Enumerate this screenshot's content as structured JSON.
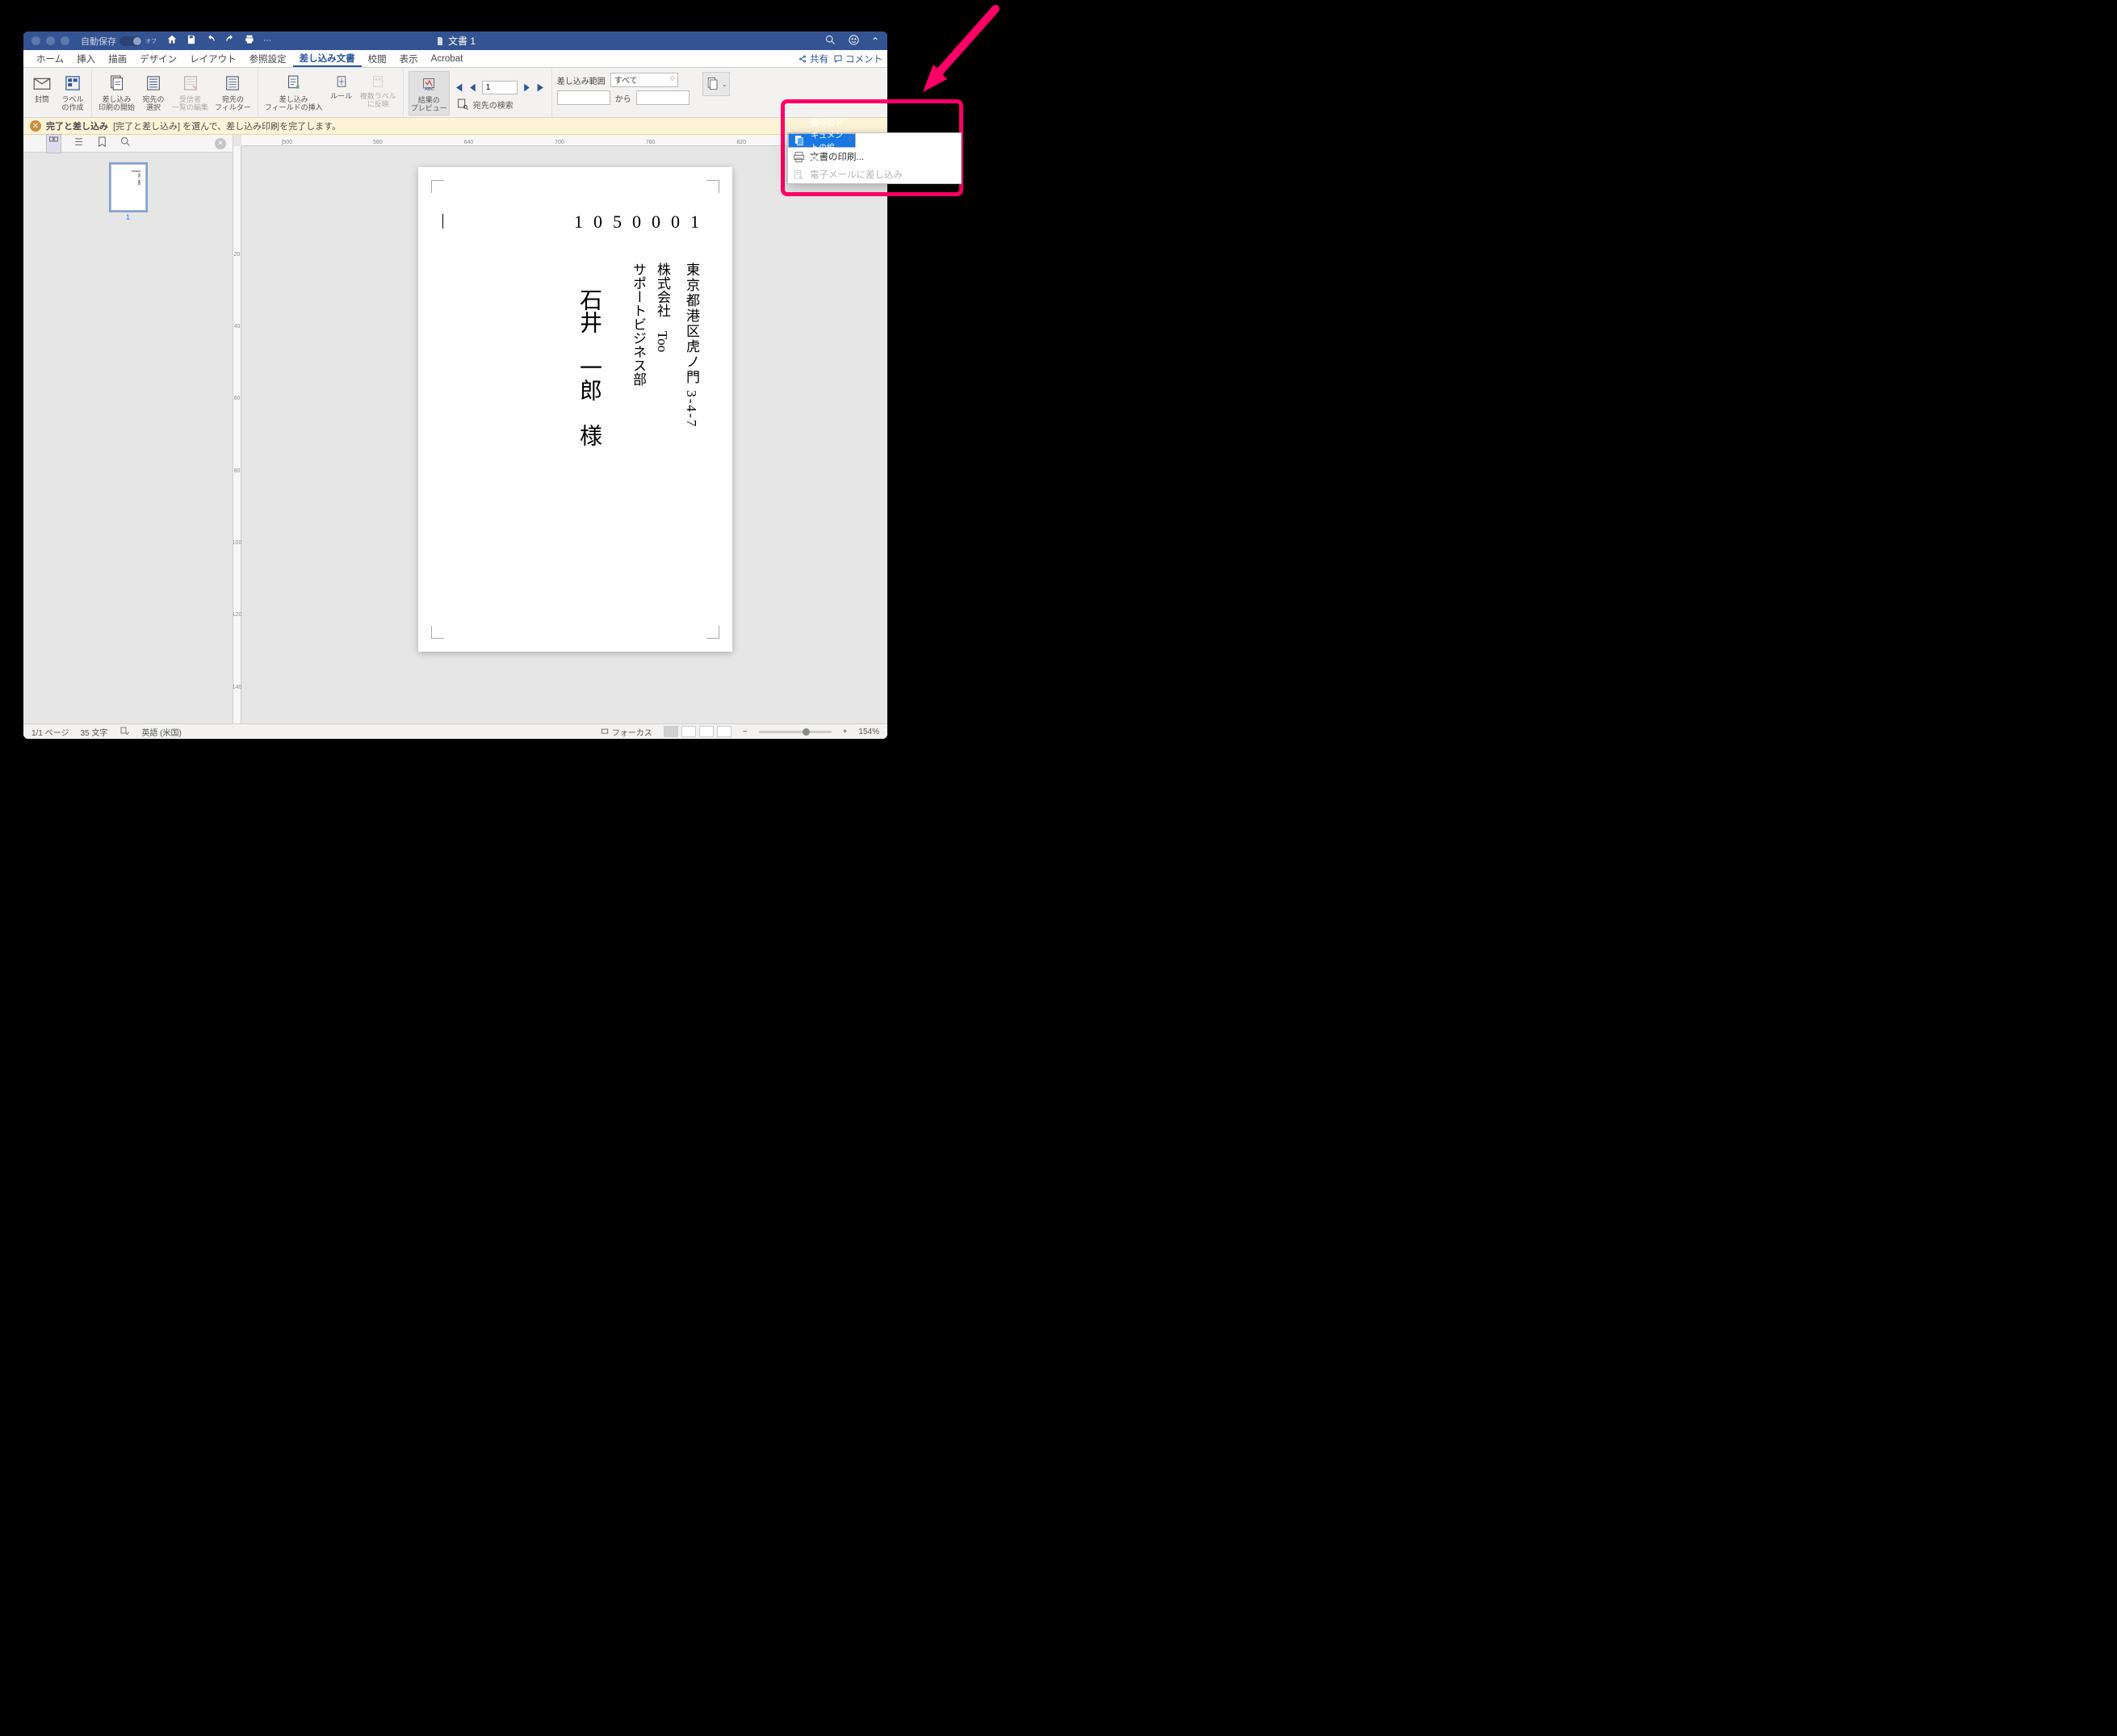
{
  "titlebar": {
    "autosave_label": "自動保存",
    "autosave_state": "オフ",
    "document_title": "文書 1"
  },
  "tabs": {
    "items": [
      "ホーム",
      "挿入",
      "描画",
      "デザイン",
      "レイアウト",
      "参照設定",
      "差し込み文書",
      "校閲",
      "表示",
      "Acrobat"
    ],
    "active_index": 6,
    "share": "共有",
    "comment": "コメント"
  },
  "ribbon": {
    "envelope": "封筒",
    "labels": "ラベル\nの作成",
    "start_merge": "差し込み\n印刷の開始",
    "select_recipients": "宛先の\n選択",
    "edit_recipients": "受信者\n一覧の編集",
    "filter_recipients": "宛先の\nフィルター",
    "insert_field": "差し込み\nフィールドの挿入",
    "rules": "ルール",
    "update_labels": "複数ラベル\nに反映",
    "preview_results": "結果の\nプレビュー",
    "find_recipient": "宛先の検索",
    "record_number": "1",
    "range_label": "差し込み範囲",
    "range_value": "すべて",
    "from_label": "から"
  },
  "infobar": {
    "title": "完了と差し込み",
    "text": "[完了と差し込み] を選んで、差し込み印刷を完了します。"
  },
  "dropdown": {
    "edit_individual": "個々のドキュメントの編集...",
    "print": "文書の印刷...",
    "email": "電子メールに差し込み"
  },
  "document": {
    "zip": "1050001",
    "address": "東京都港区虎ノ門 3-4-7",
    "company": "株式会社　Too",
    "department": "サポートビジネス部",
    "name": "石井　一郎　様"
  },
  "ruler_h": [
    "|500",
    "580",
    "640",
    "700",
    "760",
    "820",
    "|"
  ],
  "ruler_v": [
    "",
    "20",
    "40",
    "60",
    "80",
    "100",
    "120",
    "140"
  ],
  "thumbnail": {
    "page_number": "1"
  },
  "status": {
    "page": "1/1 ページ",
    "words": "35 文字",
    "language": "英語 (米国)",
    "focus": "フォーカス",
    "zoom": "154%"
  }
}
